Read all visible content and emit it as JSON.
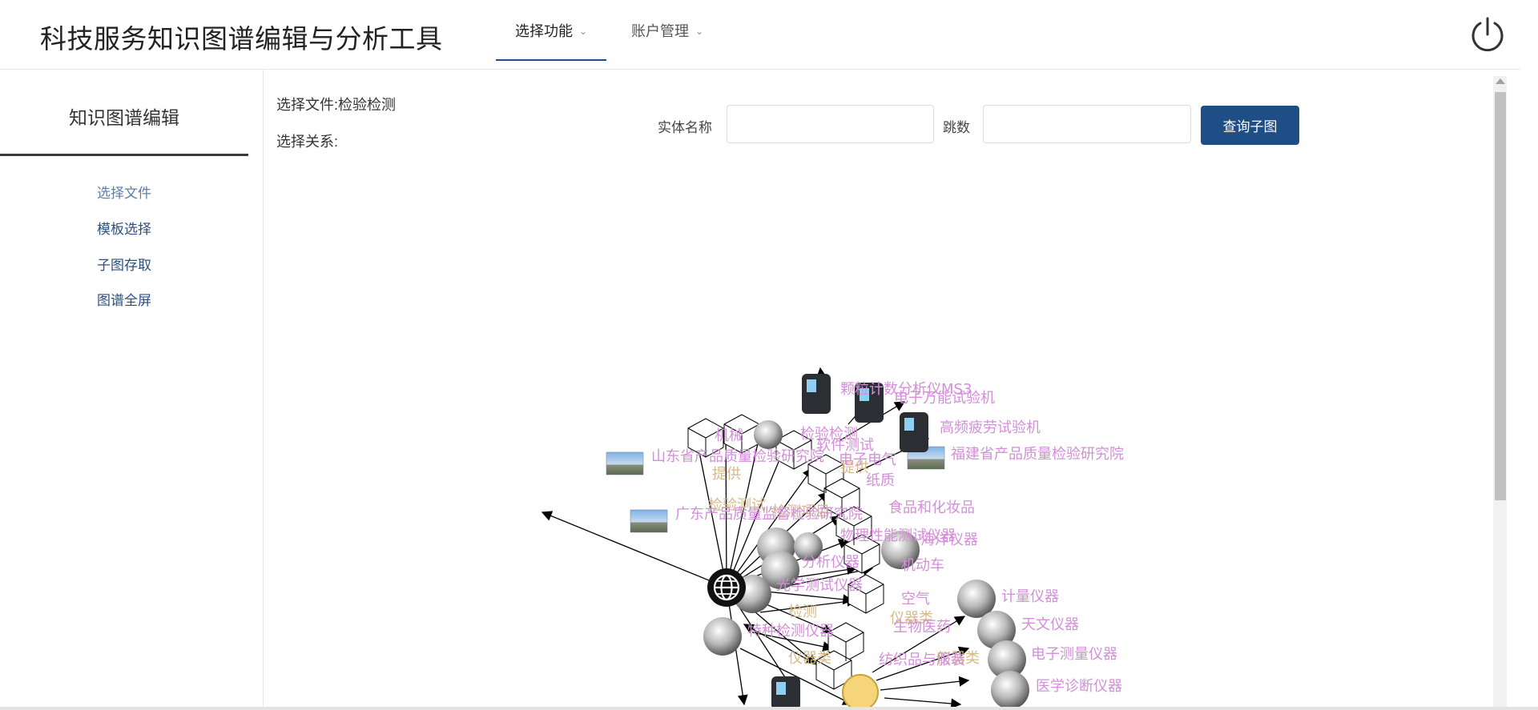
{
  "header": {
    "title": "科技服务知识图谱编辑与分析工具",
    "nav": [
      {
        "label": "选择功能"
      },
      {
        "label": "账户管理"
      }
    ]
  },
  "sidebar": {
    "title": "知识图谱编辑",
    "items": [
      {
        "label": "选择文件"
      },
      {
        "label": "模板选择"
      },
      {
        "label": "子图存取"
      },
      {
        "label": "图谱全屏"
      }
    ]
  },
  "main": {
    "file_label": "选择文件:检验检测",
    "relation_label": "选择关系:",
    "query": {
      "entity_label": "实体名称",
      "entity_value": "",
      "hops_label": "跳数",
      "hops_value": "",
      "button_label": "查询子图"
    }
  },
  "graph": {
    "node_labels": [
      "颗粒计数分析仪MS3",
      "电子万能试验机",
      "高频疲劳试验机",
      "福建省产品质量检验研究院",
      "山东省产品质量检验研究院",
      "广东产品质量监督检验研究院",
      "机械 ",
      "检验检测",
      "软件测试",
      "电子电气",
      "纸质",
      "食品和化妆品",
      "物理性能测试仪器",
      "海洋仪器",
      "机动车",
      "分析仪器",
      "光学测试仪器",
      "空气",
      "计量仪器",
      "天文仪器",
      "生物医药",
      "电子测量仪器",
      "纺织品与服装",
      "医学诊断仪器",
      "特种检测仪器"
    ],
    "relation_labels": [
      "提供",
      "提供",
      "检验测试",
      "检测项目",
      "仪器类",
      "仪器类",
      "仪器类",
      "检测"
    ]
  },
  "colors": {
    "accent": "#1f4e86",
    "node_label": "#d38fd8",
    "relation_label": "#d6b989"
  }
}
